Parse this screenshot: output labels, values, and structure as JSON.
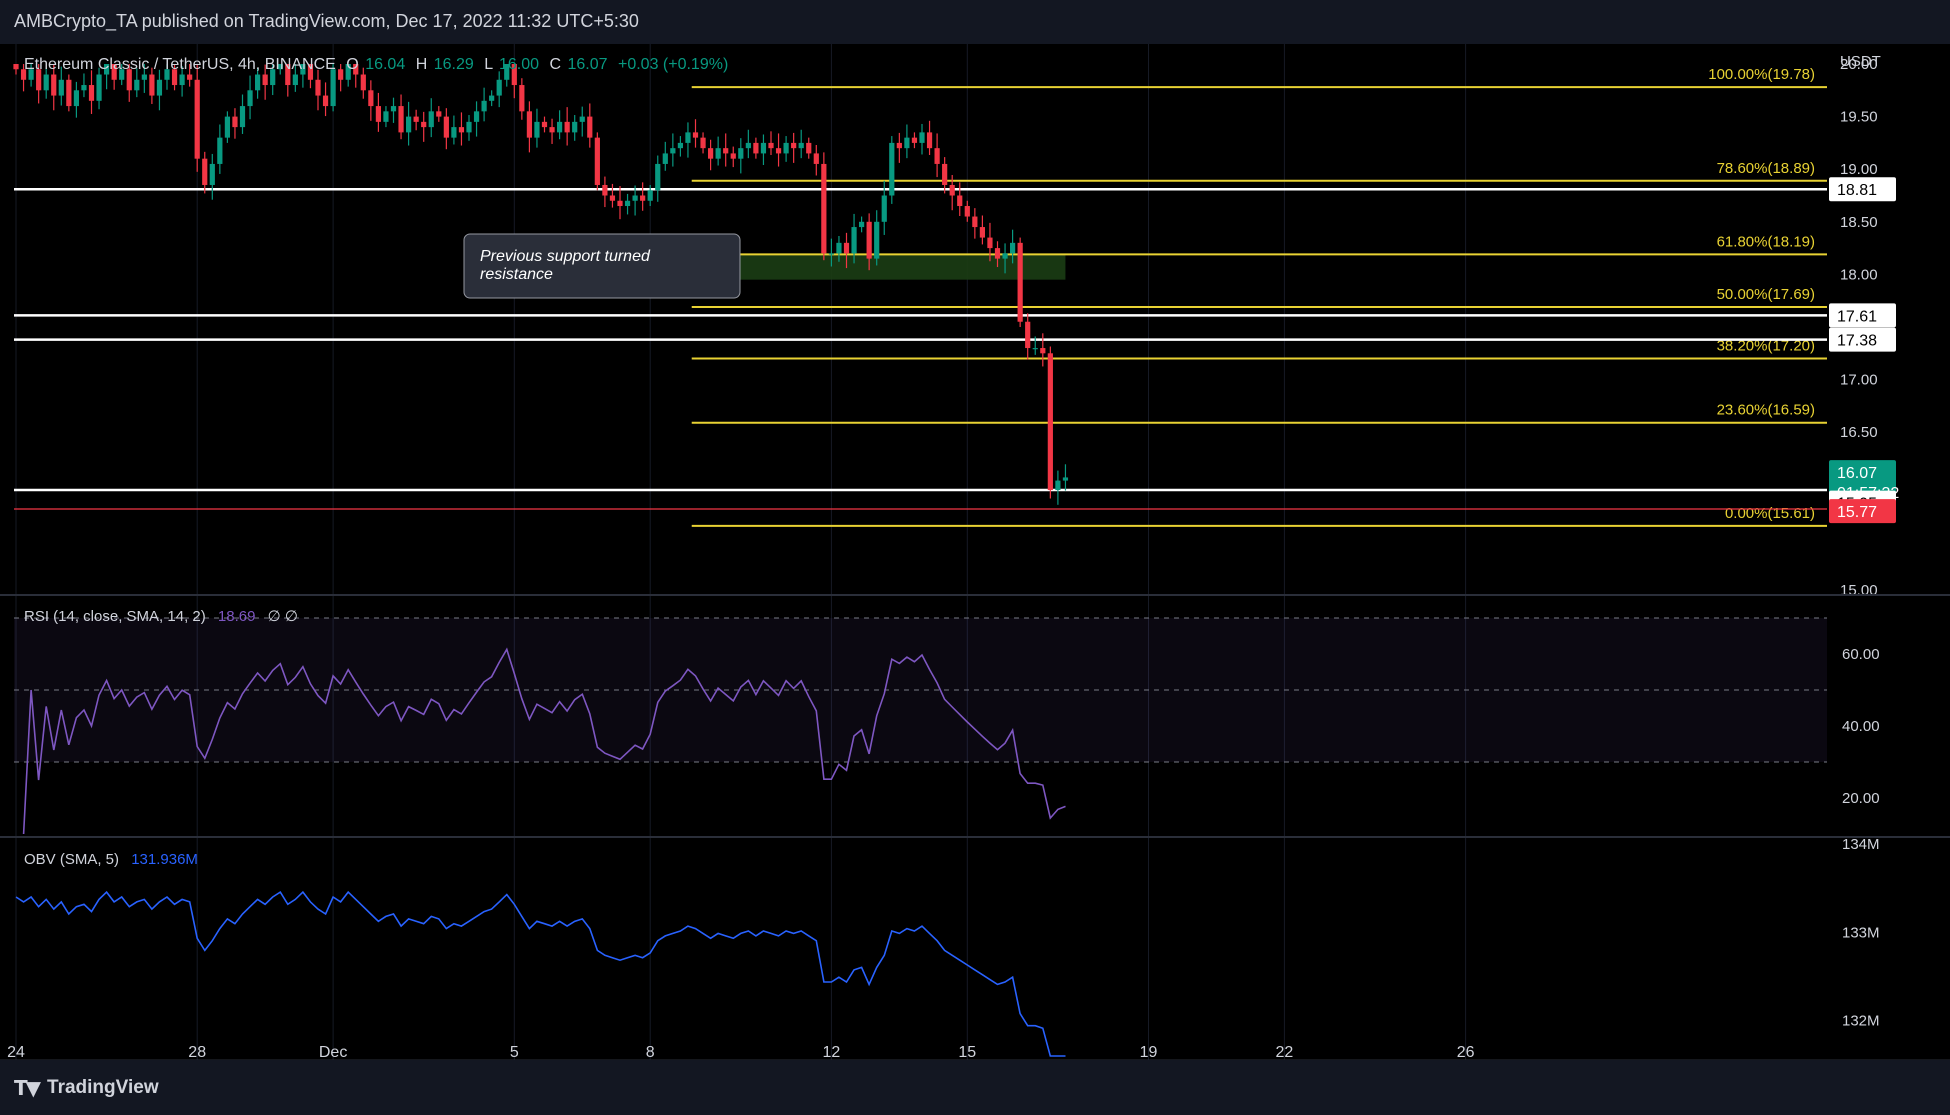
{
  "header": {
    "published": "AMBCrypto_TA published on TradingView.com, Dec 17, 2022 11:32 UTC+5:30"
  },
  "legend": {
    "symbol": "Ethereum Classic / TetherUS, 4h, BINANCE",
    "o_label": "O",
    "o": "16.04",
    "h_label": "H",
    "h": "16.29",
    "l_label": "L",
    "l": "16.00",
    "c_label": "C",
    "c": "16.07",
    "change": "+0.03 (+0.19%)"
  },
  "footer": {
    "brand": "TradingView",
    "brand_icon": "tradingview-logo-icon"
  },
  "colors": {
    "up": "#089981",
    "down": "#f23645",
    "fib": "#e8d233",
    "support": "#ffffff",
    "rsi": "#7e57c2",
    "obv": "#2962ff",
    "zone": "#1b3d14",
    "price_badge": "#089981",
    "low_badge": "#f23645"
  },
  "chart_data": [
    {
      "type": "candlestick",
      "title": "",
      "ylabel": "USDT",
      "ylim": [
        15.0,
        20.0
      ],
      "y_ticks": [
        "15.00",
        "16.50",
        "17.00",
        "18.00",
        "18.50",
        "19.00",
        "19.50",
        "20.00"
      ],
      "x_ticks": [
        {
          "label": "24",
          "t": 0
        },
        {
          "label": "28",
          "t": 24
        },
        {
          "label": "Dec",
          "t": 42
        },
        {
          "label": "5",
          "t": 66
        },
        {
          "label": "8",
          "t": 84
        },
        {
          "label": "12",
          "t": 108
        },
        {
          "label": "15",
          "t": 126
        },
        {
          "label": "19",
          "t": 150
        },
        {
          "label": "22",
          "t": 168
        },
        {
          "label": "26",
          "t": 192
        }
      ],
      "closes": [
        19.95,
        19.85,
        19.95,
        19.75,
        19.9,
        19.7,
        19.85,
        19.6,
        19.75,
        19.8,
        19.65,
        19.9,
        20.05,
        19.85,
        19.95,
        19.75,
        19.85,
        19.9,
        19.7,
        19.85,
        19.95,
        19.8,
        19.9,
        19.85,
        19.1,
        18.85,
        19.05,
        19.3,
        19.5,
        19.4,
        19.6,
        19.75,
        19.9,
        19.8,
        19.95,
        20.05,
        19.8,
        19.9,
        20.05,
        19.85,
        19.7,
        19.6,
        19.95,
        19.85,
        20.05,
        19.9,
        19.75,
        19.6,
        19.45,
        19.55,
        19.6,
        19.35,
        19.5,
        19.45,
        19.4,
        19.55,
        19.5,
        19.3,
        19.4,
        19.35,
        19.45,
        19.55,
        19.65,
        19.7,
        19.85,
        20.0,
        19.8,
        19.55,
        19.3,
        19.45,
        19.4,
        19.35,
        19.45,
        19.35,
        19.45,
        19.5,
        19.3,
        18.85,
        18.75,
        18.7,
        18.65,
        18.7,
        18.75,
        18.7,
        18.8,
        19.05,
        19.15,
        19.2,
        19.25,
        19.35,
        19.3,
        19.2,
        19.1,
        19.2,
        19.15,
        19.1,
        19.2,
        19.25,
        19.15,
        19.25,
        19.2,
        19.15,
        19.25,
        19.2,
        19.25,
        19.15,
        19.05,
        18.2,
        18.2,
        18.3,
        18.2,
        18.45,
        18.5,
        18.15,
        18.5,
        18.75,
        19.25,
        19.2,
        19.3,
        19.25,
        19.35,
        19.2,
        19.05,
        18.85,
        18.75,
        18.65,
        18.55,
        18.45,
        18.35,
        18.25,
        18.15,
        18.2,
        18.3,
        17.55,
        17.3,
        17.3,
        17.25,
        15.95,
        16.04,
        16.07
      ],
      "rsi": {
        "label": "RSI (14, close, SMA, 14, 2)",
        "value": "18.69",
        "extra": "∅ ∅",
        "ylim": [
          10,
          75
        ],
        "y_ticks": [
          "20.00",
          "40.00",
          "60.00"
        ],
        "bands": [
          30,
          70
        ],
        "mid": 50
      },
      "obv": {
        "label": "OBV (SMA, 5)",
        "value": "131.936M",
        "ylim": [
          131.6,
          134.0
        ],
        "y_ticks": [
          "132M",
          "133M",
          "134M"
        ]
      },
      "annotations": [
        {
          "text": "Previous support turned resistance",
          "lines": [
            "Previous support turned",
            "resistance"
          ],
          "target": 18.19
        }
      ],
      "fib_levels": [
        {
          "label": "100.00%(19.78)",
          "price": 19.78
        },
        {
          "label": "78.60%(18.89)",
          "price": 18.89
        },
        {
          "label": "61.80%(18.19)",
          "price": 18.19
        },
        {
          "label": "50.00%(17.69)",
          "price": 17.69
        },
        {
          "label": "38.20%(17.20)",
          "price": 17.2
        },
        {
          "label": "23.60%(16.59)",
          "price": 16.59
        },
        {
          "label": "0.00%(15.61)",
          "price": 15.61
        }
      ],
      "support_levels": [
        {
          "label": "18.81",
          "price": 18.81
        },
        {
          "label": "17.61",
          "price": 17.61
        },
        {
          "label": "17.38",
          "price": 17.38
        },
        {
          "label": "15.95",
          "price": 15.95
        }
      ],
      "zone": {
        "low": 17.95,
        "high": 18.19
      },
      "current": {
        "price": 16.07,
        "label": "16.07",
        "countdown": "01:57:32"
      },
      "low_line": {
        "price": 15.77,
        "label": "15.77"
      }
    }
  ]
}
